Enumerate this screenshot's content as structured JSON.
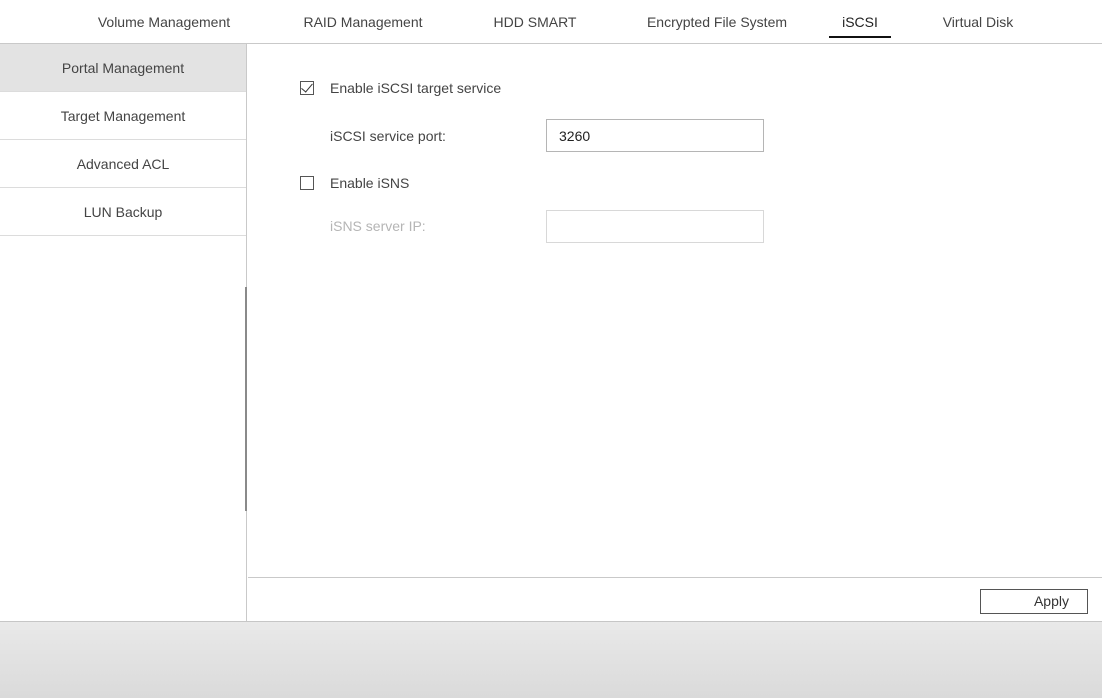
{
  "tabs": [
    {
      "label": "Volume Management",
      "active": false
    },
    {
      "label": "RAID Management",
      "active": false
    },
    {
      "label": "HDD SMART",
      "active": false
    },
    {
      "label": "Encrypted File System",
      "active": false
    },
    {
      "label": "iSCSI",
      "active": true
    },
    {
      "label": "Virtual Disk",
      "active": false
    }
  ],
  "sidebar": {
    "items": [
      {
        "label": "Portal Management",
        "active": true
      },
      {
        "label": "Target Management",
        "active": false
      },
      {
        "label": "Advanced ACL",
        "active": false
      },
      {
        "label": "LUN Backup",
        "active": false
      }
    ]
  },
  "form": {
    "enable_iscsi": {
      "label": "Enable iSCSI target service",
      "checked": true
    },
    "service_port": {
      "label": "iSCSI service port:",
      "value": "3260"
    },
    "enable_isns": {
      "label": "Enable iSNS",
      "checked": false
    },
    "isns_server_ip": {
      "label": "iSNS server IP:",
      "value": ""
    }
  },
  "footer": {
    "apply_label": "Apply"
  }
}
